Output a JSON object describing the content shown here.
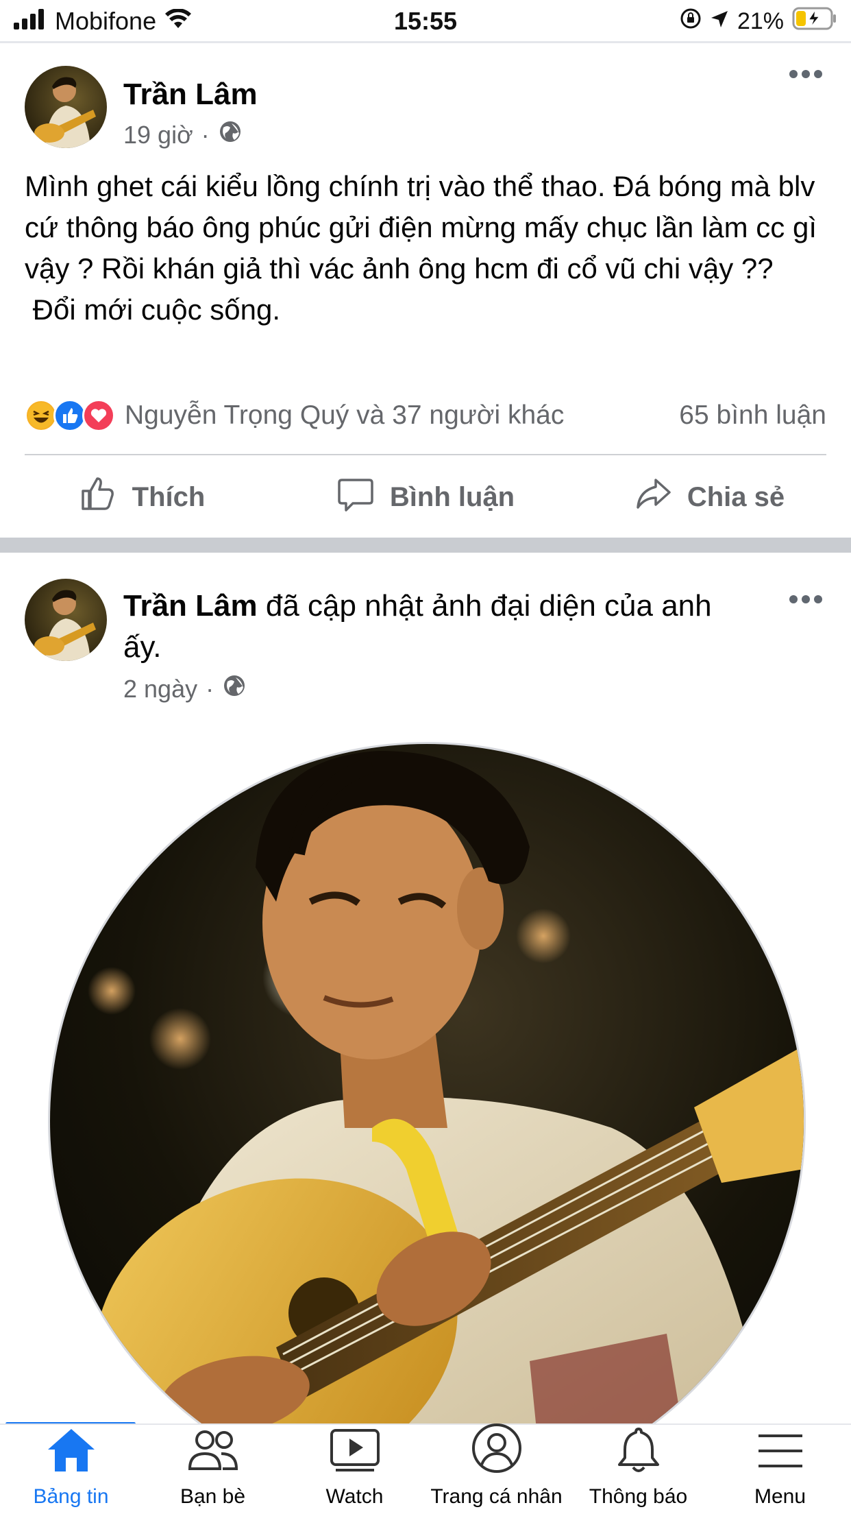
{
  "status_bar": {
    "carrier": "Mobifone",
    "time": "15:55",
    "battery": "21%"
  },
  "colors": {
    "accent": "#1877f2",
    "secondary_text": "#65676b",
    "separator": "#c9ccd1"
  },
  "posts": [
    {
      "author": "Trần Lâm",
      "time": "19 giờ",
      "privacy_icon": "globe-icon",
      "text": "Mình ghet cái kiểu lồng chính trị vào thể thao. Đá bóng mà blv cứ thông báo ông phúc gửi điện mừng mấy chục lần làm cc gì vậy ? Rồi khán giả thì vác ảnh ông hcm đi cổ vũ chi vậy ??\n Đổi mới cuộc sống.",
      "reactions": [
        "haha-icon",
        "like-icon",
        "love-icon"
      ],
      "reaction_names": "Nguyễn Trọng Quý và 37 người khác",
      "comments": "65 bình luận",
      "actions": {
        "like": "Thích",
        "comment": "Bình luận",
        "share": "Chia sẻ"
      }
    },
    {
      "author": "Trần Lâm",
      "action_text": " đã cập nhật ảnh đại diện của anh ấy.",
      "time": "2 ngày",
      "privacy_icon": "globe-icon"
    }
  ],
  "tab_bar": {
    "tabs": [
      {
        "label": "Bảng tin",
        "icon": "home-icon",
        "active": true
      },
      {
        "label": "Bạn bè",
        "icon": "friends-icon",
        "active": false
      },
      {
        "label": "Watch",
        "icon": "watch-icon",
        "active": false
      },
      {
        "label": "Trang cá nhân",
        "icon": "profile-icon",
        "active": false
      },
      {
        "label": "Thông báo",
        "icon": "bell-icon",
        "active": false
      },
      {
        "label": "Menu",
        "icon": "menu-icon",
        "active": false
      }
    ]
  }
}
